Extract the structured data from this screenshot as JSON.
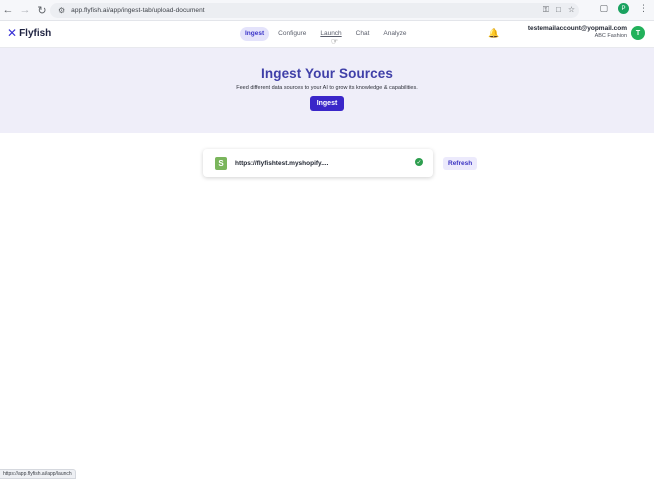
{
  "browser": {
    "url": "app.flyfish.ai/app/ingest-tab/upload-document",
    "profile_initial": "P",
    "status_url": "https://app.flyfish.ai/app/launch"
  },
  "app": {
    "logo_mark": "✕",
    "logo_name": "Flyfish",
    "tabs": [
      {
        "label": "Ingest",
        "active": true
      },
      {
        "label": "Configure",
        "active": false
      },
      {
        "label": "Launch",
        "active": false
      },
      {
        "label": "Chat",
        "active": false
      },
      {
        "label": "Analyze",
        "active": false
      }
    ],
    "account": {
      "email": "testemailaccount@yopmail.com",
      "org": "ABC Fashion",
      "avatar_initial": "T"
    }
  },
  "hero": {
    "title": "Ingest Your Sources",
    "subtitle": "Feed different data sources to your AI to grow its knowledge & capabilities.",
    "button_label": "Ingest"
  },
  "sources": [
    {
      "url": "https://flyfishtest.myshopify....",
      "icon": "shopify-icon",
      "status": "check-icon"
    }
  ],
  "refresh_label": "Refresh",
  "colors": {
    "accent": "#3a26c9",
    "hero_bg": "#efeef9",
    "success": "#2e9e4f"
  }
}
